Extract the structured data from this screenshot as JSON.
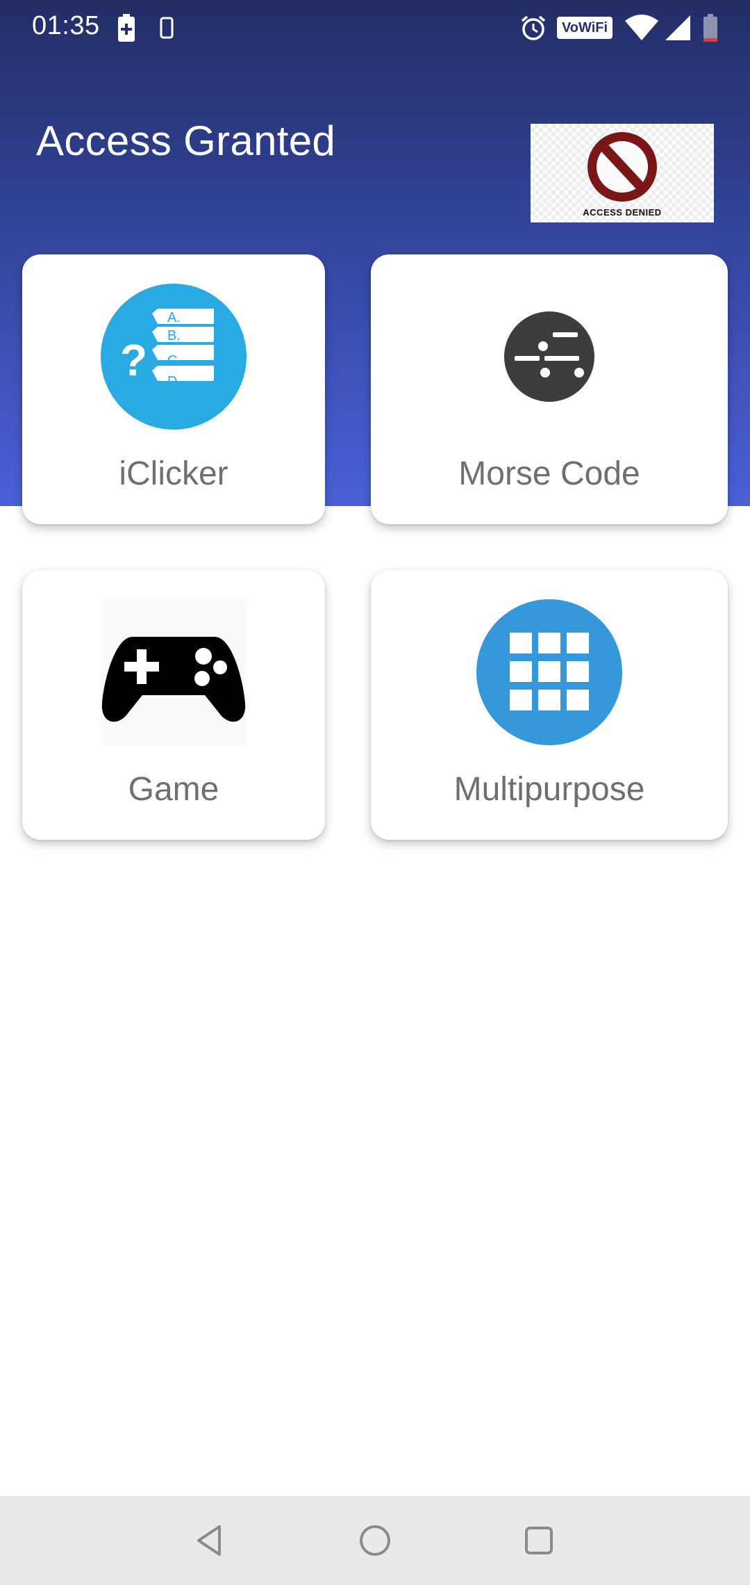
{
  "status_bar": {
    "time": "01:35",
    "vowifi": "VoWiFi"
  },
  "header": {
    "title": "Access Granted",
    "image_text": "ACCESS DENIED"
  },
  "cards": [
    {
      "label": "iClicker",
      "icon": "iclicker-icon",
      "color": "#29aae2",
      "choices": [
        "A.",
        "B.",
        "C.",
        "D."
      ]
    },
    {
      "label": "Morse Code",
      "icon": "morse-code-icon",
      "color": "#3d3d3d"
    },
    {
      "label": "Game",
      "icon": "gamepad-icon",
      "color": "#000000"
    },
    {
      "label": "Multipurpose",
      "icon": "grid-icon",
      "color": "#3697db"
    }
  ],
  "colors": {
    "header_top": "#232e66",
    "header_bottom": "#4a61d6",
    "card_label": "#6f6f6f",
    "nav_bar": "#e9e9e9"
  },
  "nav": {
    "back_icon": "back-icon",
    "home_icon": "home-icon",
    "recents_icon": "recents-icon"
  }
}
